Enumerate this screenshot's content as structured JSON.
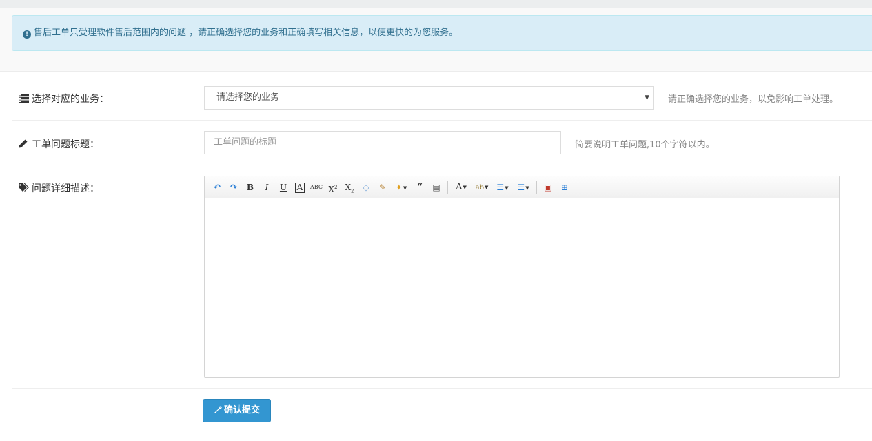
{
  "notice": {
    "icon": "exclamation-circle-icon",
    "text": "售后工单只受理软件售后范围内的问题 ，请正确选择您的业务和正确填写相关信息，以便更快的为您服务。"
  },
  "form": {
    "business": {
      "icon": "server-icon",
      "label": "选择对应的业务：",
      "selected": "请选择您的业务",
      "help": "请正确选择您的业务，以免影响工单处理。"
    },
    "title": {
      "icon": "pencil-icon",
      "label": "工单问题标题：",
      "placeholder": "工单问题的标题",
      "help": "简要说明工单问题,10个字符以内。"
    },
    "detail": {
      "icon": "tags-icon",
      "label": "问题详细描述：",
      "toolbar": [
        "undo-icon",
        "redo-icon",
        "bold-icon",
        "italic-icon",
        "underline-icon",
        "text-border-icon",
        "strikethrough-icon",
        "superscript-icon",
        "subscript-icon",
        "eraser-icon",
        "format-brush-icon",
        "magic-wand-icon",
        "blockquote-icon",
        "paste-plain-icon",
        "font-color-icon",
        "highlight-icon",
        "ordered-list-icon",
        "unordered-list-icon",
        "image-icon",
        "insert-media-icon"
      ]
    },
    "submit_label": "确认提交",
    "submit_icon": "wrench-icon"
  },
  "colors": {
    "notice_bg": "#d9edf7",
    "notice_text": "#31708f",
    "primary": "#3396d1"
  }
}
